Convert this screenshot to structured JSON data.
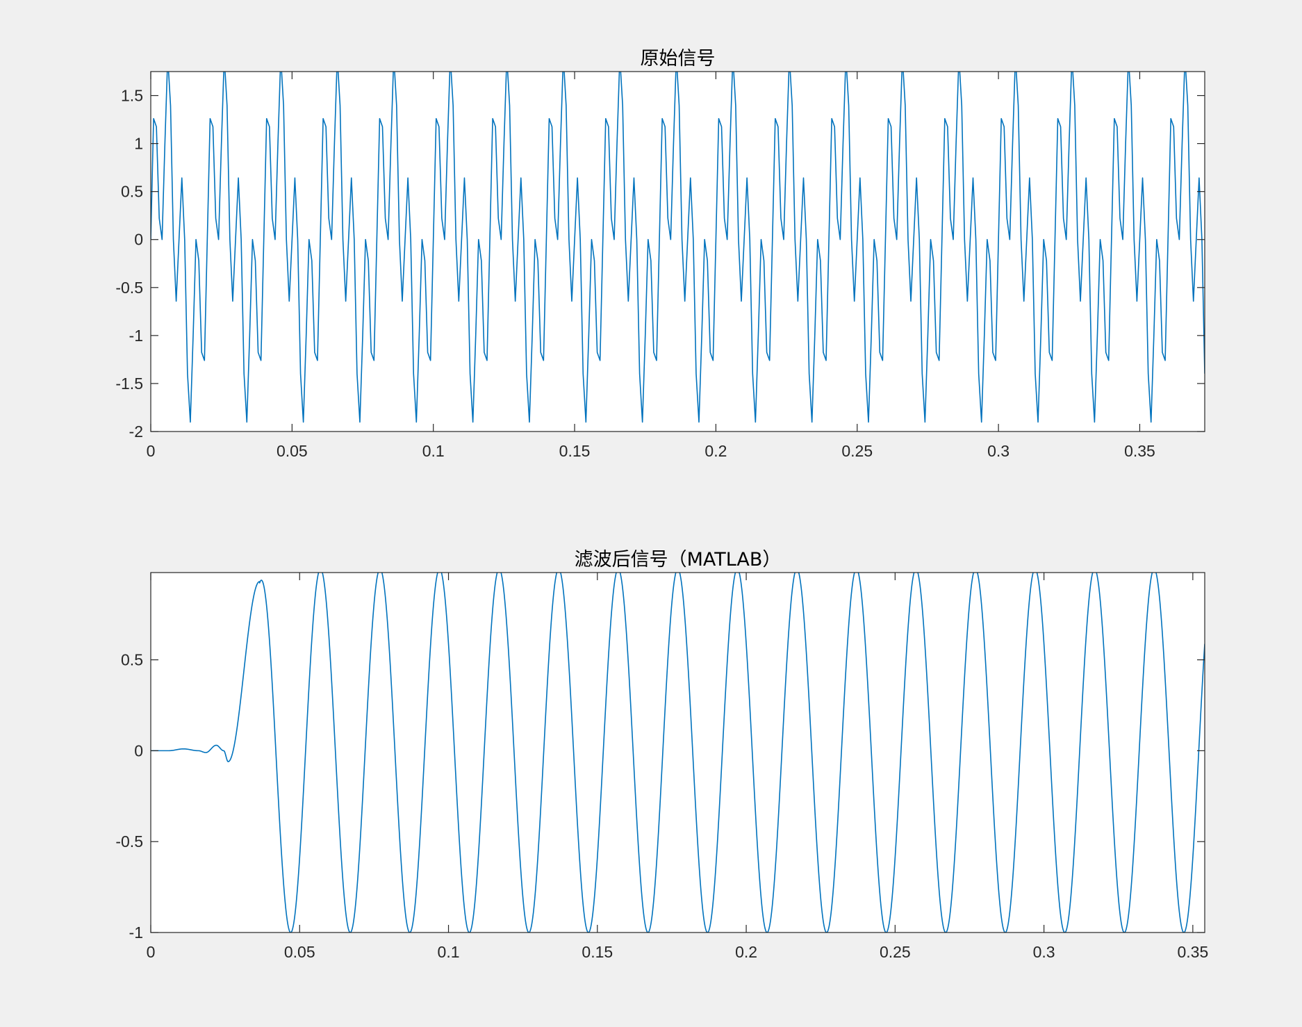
{
  "figure": {
    "background": "#f0f0f0",
    "axes_background": "#ffffff",
    "axes_color": "#262626",
    "line_color": "#0072bd"
  },
  "chart_data": [
    {
      "type": "line",
      "title": "原始信号",
      "xlabel": "",
      "ylabel": "",
      "xlim": [
        0,
        0.373
      ],
      "ylim": [
        -2,
        1.75
      ],
      "xticks": [
        0,
        0.05,
        0.1,
        0.15,
        0.2,
        0.25,
        0.3,
        0.35
      ],
      "xtick_labels": [
        "0",
        "0.05",
        "0.1",
        "0.15",
        "0.2",
        "0.25",
        "0.3",
        "0.35"
      ],
      "yticks": [
        -2,
        -1.5,
        -1,
        -0.5,
        0,
        0.5,
        1,
        1.5
      ],
      "ytick_labels": [
        "-2",
        "-1.5",
        "-1",
        "-0.5",
        "0",
        "0.5",
        "1",
        "1.5"
      ],
      "grid": false,
      "series": [
        {
          "formula": "sin(2*pi*50*t) + sin(2*pi*200*t)",
          "components": [
            {
              "amplitude": 1,
              "frequency_hz": 50
            },
            {
              "amplitude": 1,
              "frequency_hz": 200
            }
          ],
          "sample_rate_hz": 1000,
          "t_start": 0,
          "t_end": 0.373
        }
      ]
    },
    {
      "type": "line",
      "title": "滤波后信号（MATLAB）",
      "xlabel": "",
      "ylabel": "",
      "xlim": [
        0,
        0.354
      ],
      "ylim": [
        -1,
        0.98
      ],
      "xticks": [
        0,
        0.05,
        0.1,
        0.15,
        0.2,
        0.25,
        0.3,
        0.35
      ],
      "xtick_labels": [
        "0",
        "0.05",
        "0.1",
        "0.15",
        "0.2",
        "0.25",
        "0.3",
        "0.35"
      ],
      "yticks": [
        -1,
        -0.5,
        0,
        0.5
      ],
      "ytick_labels": [
        "-1",
        "-0.5",
        "0",
        "0.5"
      ],
      "grid": false,
      "series": [
        {
          "formula": "sin(2*pi*50*(t - 0.032)) after filter settling",
          "frequency_hz": 50,
          "amplitude": 1,
          "delay_s": 0.032,
          "settle_start_s": 0.026,
          "first_peak": [
            0.0365,
            0.93
          ],
          "transient_points": [
            [
              0,
              0
            ],
            [
              0.006,
              0
            ],
            [
              0.011,
              0.01
            ],
            [
              0.016,
              0
            ],
            [
              0.0185,
              -0.01
            ],
            [
              0.022,
              0.03
            ],
            [
              0.0245,
              0
            ],
            [
              0.026,
              -0.06
            ]
          ],
          "sample_rate_hz": 1000,
          "t_start": 0,
          "t_end": 0.354
        }
      ]
    }
  ]
}
